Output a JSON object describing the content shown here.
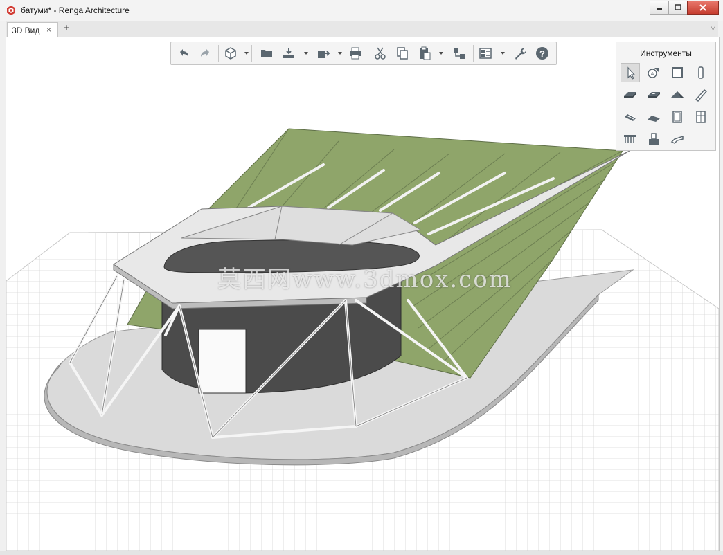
{
  "window": {
    "title": "батуми* - Renga Architecture",
    "app_icon": "renga-logo-icon",
    "buttons": [
      "minimize-icon",
      "maximize-icon",
      "close-icon"
    ]
  },
  "tabs": {
    "items": [
      {
        "label": "3D Вид",
        "close": "×"
      }
    ],
    "add": "+",
    "menu": "▽"
  },
  "toolbar": {
    "buttons": [
      "undo-icon",
      "redo-icon",
      "view-cube-icon",
      "open-folder-icon",
      "import-icon",
      "export-icon",
      "print-icon",
      "cut-icon",
      "copy-icon",
      "paste-icon",
      "structure-icon",
      "layers-icon",
      "settings-wrench-icon",
      "help-icon"
    ]
  },
  "tools_panel": {
    "title": "Инструменты",
    "tools": [
      "select-icon",
      "level-icon",
      "wall-icon",
      "column-icon",
      "floor-icon",
      "opening-icon",
      "roof-icon",
      "beam-icon",
      "stair-icon",
      "ramp-icon",
      "window-icon",
      "door-icon",
      "railing-icon",
      "equipment-icon",
      "duct-icon"
    ],
    "selected": "select-icon"
  },
  "watermark": "莫西网www.3dmox.com",
  "colors": {
    "canvas_green": "#8fa56a",
    "roof_white": "#e8e8e8",
    "drum_dark": "#4a4a4a",
    "grid": "#d8d8d8",
    "icon_gray": "#5b6770",
    "close_red": "#c9463a"
  }
}
